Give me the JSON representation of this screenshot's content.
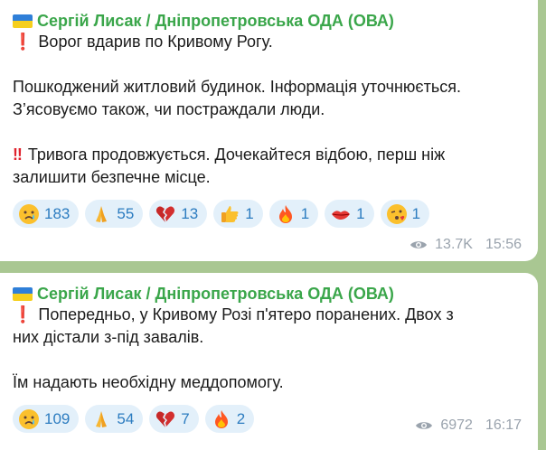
{
  "messages": [
    {
      "author": "Сергій Лисак / Дніпропетровська ОДА (ОВА)",
      "lines": [
        "Ворог вдарив по Кривому Рогу.",
        "",
        "Пошкоджений житловий будинок. Інформація уточнюється.",
        "З’ясовуємо також, чи постраждали люди.",
        "",
        "Тривога продовжується. Дочекайтеся відбою, перш ніж",
        "залишити безпечне місце."
      ],
      "reactions": [
        {
          "icon": "crying-face-icon",
          "count": "183"
        },
        {
          "icon": "folded-hands-icon",
          "count": "55"
        },
        {
          "icon": "broken-heart-icon",
          "count": "13"
        },
        {
          "icon": "thumbs-up-icon",
          "count": "1"
        },
        {
          "icon": "fire-icon",
          "count": "1"
        },
        {
          "icon": "kiss-lips-icon",
          "count": "1"
        },
        {
          "icon": "kissing-face-icon",
          "count": "1"
        }
      ],
      "views": "13.7K",
      "time": "15:56"
    },
    {
      "author": "Сергій Лисак / Дніпропетровська ОДА (ОВА)",
      "lines": [
        "Попередньо, у Кривому Розі п'ятеро поранених. Двох з",
        "них дістали з-під завалів.",
        "",
        "Їм надають необхідну меддопомогу."
      ],
      "reactions": [
        {
          "icon": "crying-face-icon",
          "count": "109"
        },
        {
          "icon": "folded-hands-icon",
          "count": "54"
        },
        {
          "icon": "broken-heart-icon",
          "count": "7"
        },
        {
          "icon": "fire-icon",
          "count": "2"
        }
      ],
      "views": "6972",
      "time": "16:17"
    }
  ],
  "colors": {
    "background": "#a9c792",
    "author": "#3aa64a",
    "reaction_bg": "#e3f0fa",
    "reaction_text": "#2c7cc0",
    "meta": "#9aa3ad"
  }
}
